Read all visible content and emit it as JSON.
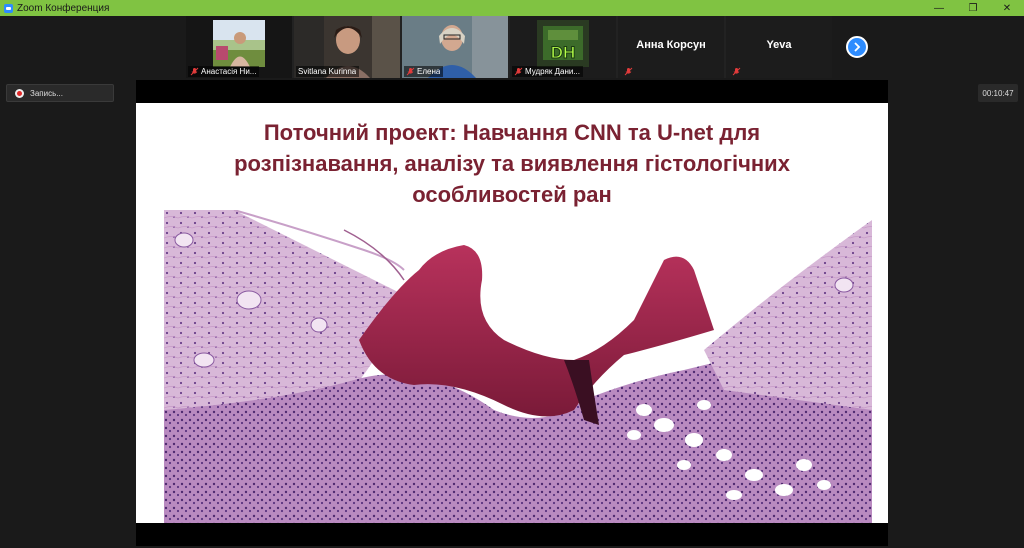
{
  "window": {
    "title": "Zoom Конференция",
    "controls": [
      "—",
      "❐",
      "✕"
    ]
  },
  "participants": [
    {
      "name": "Анастасія Ни...",
      "muted": true,
      "has_video": true
    },
    {
      "name": "Svitlana Kurinna",
      "muted": false,
      "has_video": true,
      "active_speaker": true
    },
    {
      "name": "Елена",
      "muted": true,
      "has_video": true
    },
    {
      "name": "Мудряк Дани...",
      "muted": true,
      "has_video": true,
      "avatar_text": "DH"
    },
    {
      "name": "Анна Корсун",
      "muted": true,
      "has_video": false
    },
    {
      "name": "Yeva",
      "muted": true,
      "has_video": false
    }
  ],
  "recording": {
    "label": "Запись..."
  },
  "timer": {
    "value": "00:10:47"
  },
  "slide": {
    "title_line1": "Поточний проект: Навчання CNN та U-net для",
    "title_line2": "розпізнавання, аналізу та виявлення гістологічних",
    "title_line3": "особливостей ран"
  },
  "colors": {
    "titlebar": "#80c342",
    "accent": "#2d8cff",
    "slide_title": "#7a2232",
    "active_border": "#9bd24a"
  },
  "icons": {
    "mute": "mic-muted-icon",
    "next": "chevron-right-icon",
    "record": "record-icon"
  }
}
